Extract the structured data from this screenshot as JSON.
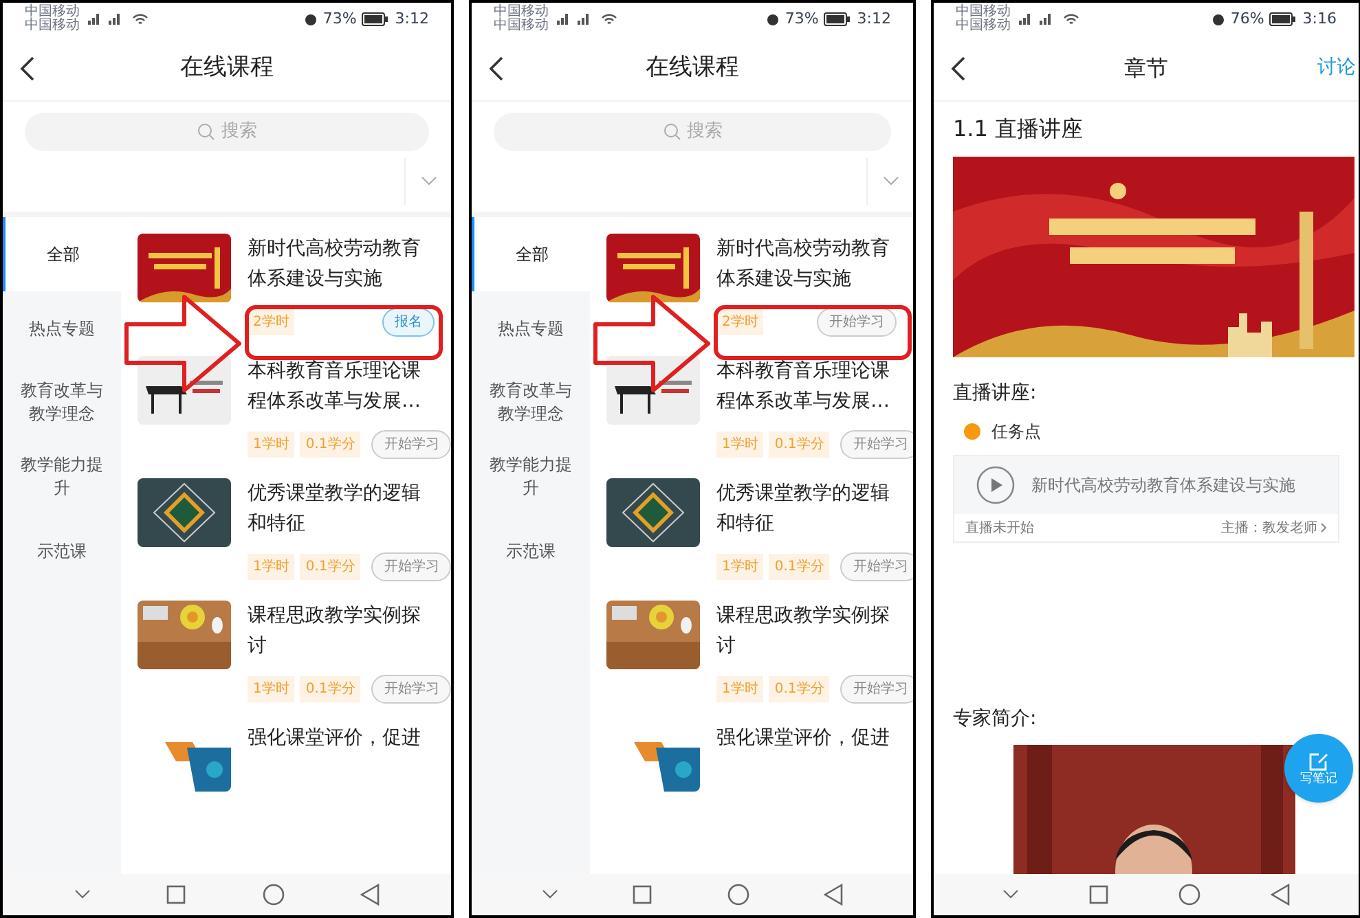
{
  "phones": [
    {
      "kind": "course_list",
      "status": {
        "carriers": [
          "中国移动",
          "中国移动"
        ],
        "battery": "73%",
        "time": "3:12"
      },
      "title": "在线课程",
      "search": {
        "placeholder": "搜索"
      },
      "categories": [
        {
          "label": "全部",
          "selected": true
        },
        {
          "label": "热点专题",
          "selected": false
        },
        {
          "label": "教育改革与教学理念",
          "selected": false
        },
        {
          "label": "教学能力提升",
          "selected": false
        },
        {
          "label": "示范课",
          "selected": false
        }
      ],
      "courses": [
        {
          "title": "新时代高校劳动教育体系建设与实施",
          "tags": [
            "2学时"
          ],
          "action": {
            "kind": "enroll",
            "label": "报名"
          }
        },
        {
          "title": "本科教育音乐理论课程体系改革与发展…",
          "tags": [
            "1学时",
            "0.1学分"
          ],
          "action": {
            "kind": "start",
            "label": "开始学习"
          }
        },
        {
          "title": "优秀课堂教学的逻辑和特征",
          "tags": [
            "1学时",
            "0.1学分"
          ],
          "action": {
            "kind": "start",
            "label": "开始学习"
          }
        },
        {
          "title": "课程思政教学实例探讨",
          "tags": [
            "1学时",
            "0.1学分"
          ],
          "action": {
            "kind": "start",
            "label": "开始学习"
          }
        },
        {
          "title": "强化课堂评价，促进"
        }
      ]
    },
    {
      "kind": "course_list",
      "status": {
        "carriers": [
          "中国移动",
          "中国移动"
        ],
        "battery": "73%",
        "time": "3:12"
      },
      "title": "在线课程",
      "search": {
        "placeholder": "搜索"
      },
      "categories": [
        {
          "label": "全部",
          "selected": true
        },
        {
          "label": "热点专题",
          "selected": false
        },
        {
          "label": "教育改革与教学理念",
          "selected": false
        },
        {
          "label": "教学能力提升",
          "selected": false
        },
        {
          "label": "示范课",
          "selected": false
        }
      ],
      "courses": [
        {
          "title": "新时代高校劳动教育体系建设与实施",
          "tags": [
            "2学时"
          ],
          "action": {
            "kind": "start",
            "label": "开始学习"
          }
        },
        {
          "title": "本科教育音乐理论课程体系改革与发展…",
          "tags": [
            "1学时",
            "0.1学分"
          ],
          "action": {
            "kind": "start",
            "label": "开始学习"
          }
        },
        {
          "title": "优秀课堂教学的逻辑和特征",
          "tags": [
            "1学时",
            "0.1学分"
          ],
          "action": {
            "kind": "start",
            "label": "开始学习"
          }
        },
        {
          "title": "课程思政教学实例探讨",
          "tags": [
            "1学时",
            "0.1学分"
          ],
          "action": {
            "kind": "start",
            "label": "开始学习"
          }
        },
        {
          "title": "强化课堂评价，促进"
        }
      ]
    },
    {
      "kind": "chapter",
      "status": {
        "carriers": [
          "中国移动",
          "中国移动"
        ],
        "battery": "76%",
        "time": "3:16"
      },
      "title": "章节",
      "header_action": "讨论",
      "section_title": "1.1 直播讲座",
      "live_label": "直播讲座:",
      "task_point": "任务点",
      "live": {
        "title": "新时代高校劳动教育体系建设与实施",
        "status": "直播未开始",
        "host": "主播：教发老师"
      },
      "expert_label": "专家简介:",
      "note_button": "写笔记"
    }
  ]
}
